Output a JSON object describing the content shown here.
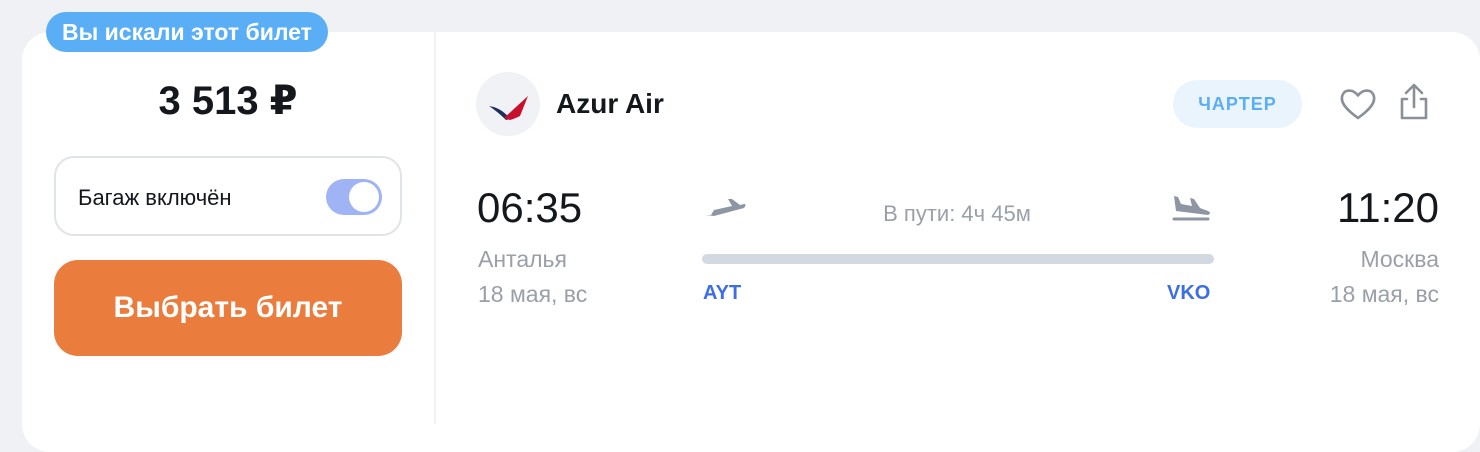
{
  "badge": "Вы искали этот билет",
  "price": "3 513 ₽",
  "baggage": {
    "label": "Багаж включён",
    "enabled": true
  },
  "select_button": "Выбрать билет",
  "airline": {
    "name": "Azur Air",
    "logo_colors": [
      "#1e2f5c",
      "#c8102e"
    ]
  },
  "charter_label": "ЧАРТЕР",
  "actions": {
    "favorite_icon": "heart-icon",
    "share_icon": "share-icon"
  },
  "departure": {
    "time": "06:35",
    "city": "Анталья",
    "date": "18 мая, вс",
    "code": "AYT"
  },
  "arrival": {
    "time": "11:20",
    "city": "Москва",
    "date": "18 мая, вс",
    "code": "VKO"
  },
  "duration": "В пути: 4ч 45м",
  "colors": {
    "accent_orange": "#ea7d3e",
    "badge_blue": "#5aaef5",
    "code_blue": "#3c6fe6",
    "toggle_on": "#9fb3f5"
  }
}
